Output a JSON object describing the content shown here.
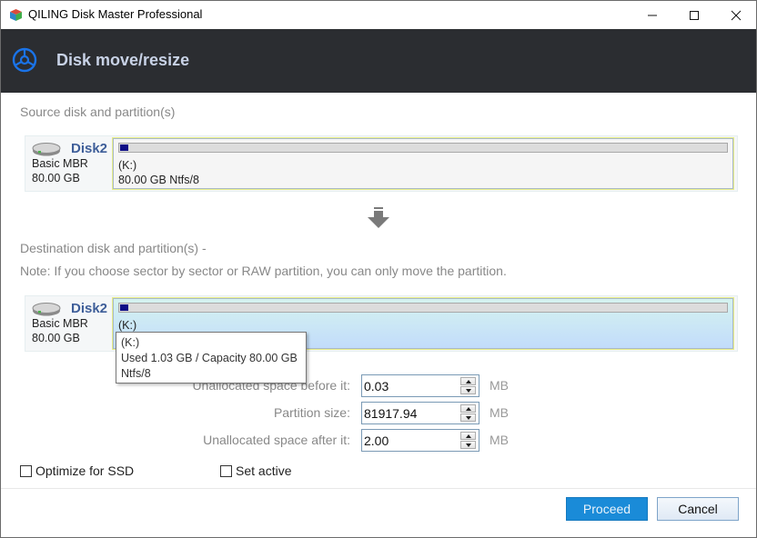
{
  "window": {
    "title": "QILING Disk Master Professional",
    "controls": {
      "minimize": "minimize",
      "maximize": "maximize",
      "close": "close"
    }
  },
  "header": {
    "icon": "steering-wheel-icon",
    "title": "Disk move/resize",
    "accent_color": "#1a73e8"
  },
  "source": {
    "section_label": "Source disk and partition(s)",
    "disk": {
      "name": "Disk2",
      "type": "Basic MBR",
      "size": "80.00 GB",
      "partition": {
        "label": "(K:)",
        "detail": "80.00 GB Ntfs/8",
        "used_fraction": 0.013
      }
    }
  },
  "destination": {
    "section_label": "Destination disk and partition(s) -",
    "note": "Note: If you choose sector by sector or RAW partition, you can only move the partition.",
    "disk": {
      "name": "Disk2",
      "type": "Basic MBR",
      "size": "80.00 GB",
      "partition": {
        "label": "(K:)",
        "used_fraction": 0.013
      }
    },
    "tooltip": {
      "line1": "(K:)",
      "line2": "Used 1.03 GB / Capacity 80.00 GB",
      "line3": "Ntfs/8"
    }
  },
  "fields": {
    "before": {
      "label": "Unallocated space before it:",
      "value": "0.03",
      "unit": "MB"
    },
    "size": {
      "label": "Partition size:",
      "value": "81917.94",
      "unit": "MB"
    },
    "after": {
      "label": "Unallocated space after it:",
      "value": "2.00",
      "unit": "MB"
    }
  },
  "options": {
    "optimize_ssd": {
      "label": "Optimize for SSD",
      "checked": false
    },
    "set_active": {
      "label": "Set active",
      "checked": false
    }
  },
  "buttons": {
    "proceed": "Proceed",
    "cancel": "Cancel"
  }
}
